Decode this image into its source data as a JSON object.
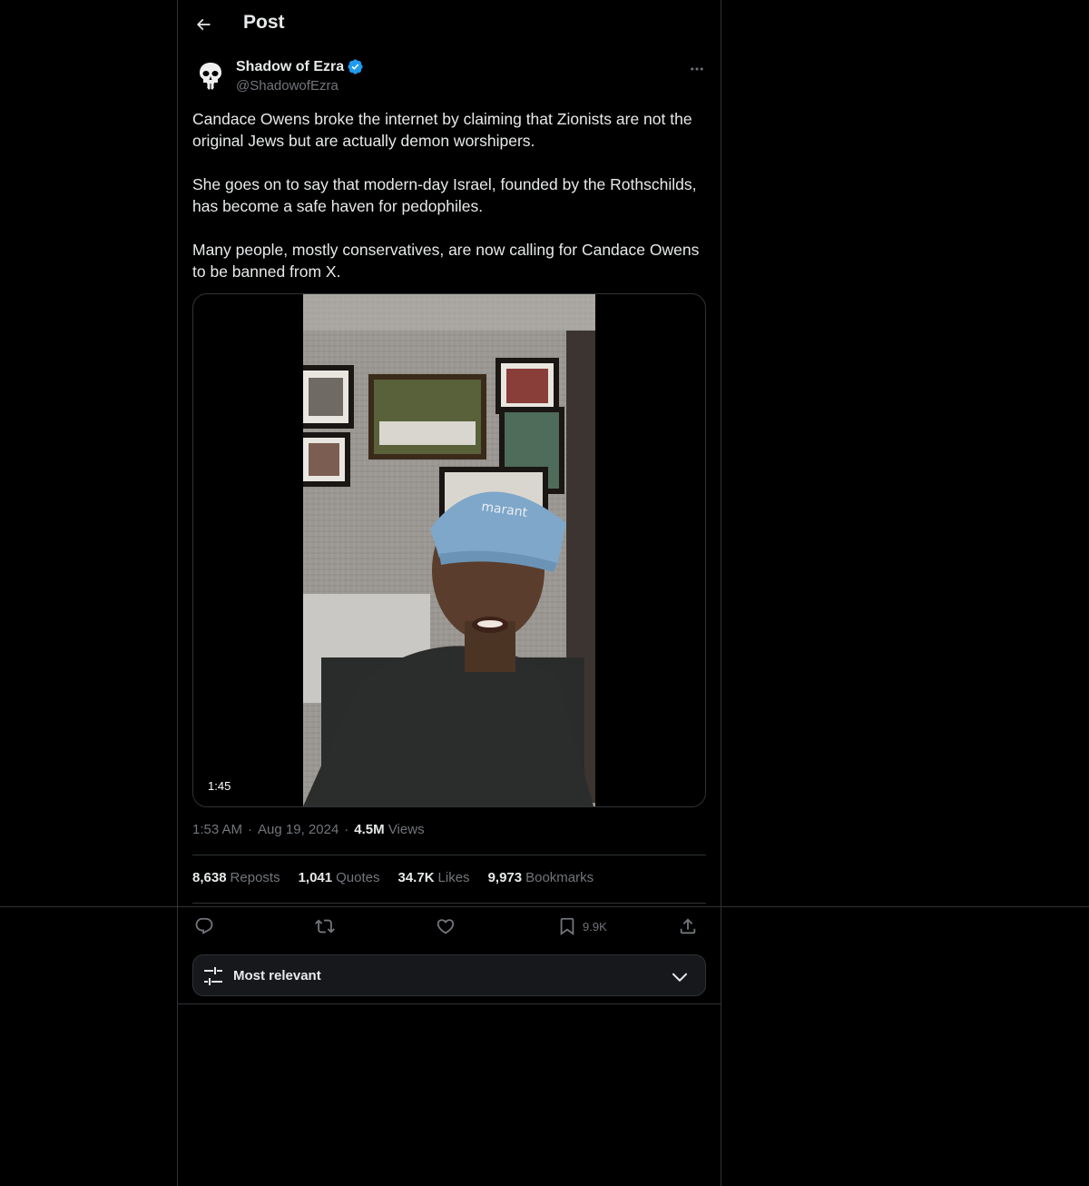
{
  "header": {
    "title": "Post"
  },
  "author": {
    "name": "Shadow of Ezra",
    "handle": "@ShadowofEzra",
    "verified": true
  },
  "tweet": {
    "paragraphs": [
      "Candace Owens broke the internet by claiming that Zionists are not the original Jews but are actually demon worshipers.",
      "She goes on to say that modern-day Israel, founded by the Rothschilds, has become a safe haven for pedophiles.",
      "Many people, mostly conservatives, are now calling for Candace Owens to be banned from X."
    ]
  },
  "media": {
    "duration": "1:45",
    "cap_text": "marant"
  },
  "meta": {
    "time": "1:53 AM",
    "separator": "·",
    "date": "Aug 19, 2024",
    "views_count": "4.5M",
    "views_label": "Views"
  },
  "stats": {
    "reposts_count": "8,638",
    "reposts_label": "Reposts",
    "quotes_count": "1,041",
    "quotes_label": "Quotes",
    "likes_count": "34.7K",
    "likes_label": "Likes",
    "bookmarks_count": "9,973",
    "bookmarks_label": "Bookmarks"
  },
  "actions": {
    "bookmark_count": "9.9K"
  },
  "sort": {
    "label": "Most relevant"
  },
  "colors": {
    "accent": "#1d9bf0",
    "text": "#e7e9ea",
    "muted": "#71767b",
    "border": "#2f3336",
    "sort_bg": "#16181c"
  }
}
